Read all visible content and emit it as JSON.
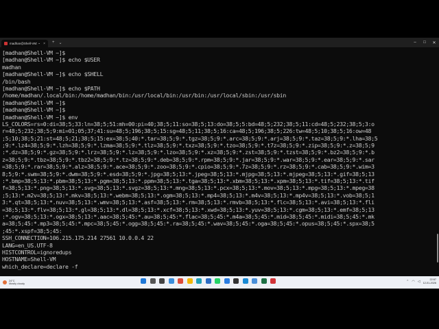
{
  "window": {
    "tab_title": "madhan@Shell-VM: ~",
    "close_glyph": "×",
    "new_tab_glyph": "+",
    "dropdown_glyph": "⌄",
    "min_glyph": "–",
    "max_glyph": "□",
    "close_win_glyph": "✕"
  },
  "terminal": {
    "lines": [
      "[madhan@Shell-VM ~]$",
      "[madhan@Shell-VM ~]$ echo $USER",
      "madhan",
      "[madhan@Shell-VM ~]$ echo $SHELL",
      "/bin/bash",
      "[madhan@Shell-VM ~]$ echo $PATH",
      "/home/madhan/.local/bin:/home/madhan/bin:/usr/local/bin:/usr/bin:/usr/local/sbin:/usr/sbin",
      "[madhan@Shell-VM ~]$",
      "[madhan@Shell-VM ~]$",
      "[madhan@Shell-VM ~]$ env",
      "LS_COLORS=rs=0:di=38;5;33:ln=38;5;51:mh=00:pi=40;38;5;11:so=38;5;13:do=38;5;5:bd=48;5;232;38;5;11:cd=48;5;232;38;5;3:o",
      "r=48;5;232;38;5;9:mi=01;05;37;41:su=48;5;196;38;5;15:sg=48;5;11;38;5;16:ca=48;5;196;38;5;226:tw=48;5;10;38;5;16:ow=48",
      ";5;10;38;5;21:st=48;5;21;38;5;15:ex=38;5;40:*.tar=38;5;9:*.tgz=38;5;9:*.arc=38;5;9:*.arj=38;5;9:*.taz=38;5;9:*.lha=38;5",
      ";9:*.lz4=38;5;9:*.lzh=38;5;9:*.lzma=38;5;9:*.tlz=38;5;9:*.txz=38;5;9:*.tzo=38;5;9:*.t7z=38;5;9:*.zip=38;5;9:*.z=38;5;9",
      ":*.dz=38;5;9:*.gz=38;5;9:*.lrz=38;5;9:*.lz=38;5;9:*.lzo=38;5;9:*.xz=38;5;9:*.zst=38;5;9:*.tzst=38;5;9:*.bz2=38;5;9:*.b",
      "z=38;5;9:*.tbz=38;5;9:*.tbz2=38;5;9:*.tz=38;5;9:*.deb=38;5;9:*.rpm=38;5;9:*.jar=38;5;9:*.war=38;5;9:*.ear=38;5;9:*.sar",
      "=38;5;9:*.rar=38;5;9:*.alz=38;5;9:*.ace=38;5;9:*.zoo=38;5;9:*.cpio=38;5;9:*.7z=38;5;9:*.rz=38;5;9:*.cab=38;5;9:*.wim=3",
      "8;5;9:*.swm=38;5;9:*.dwm=38;5;9:*.esd=38;5;9:*.jpg=38;5;13:*.jpeg=38;5;13:*.mjpg=38;5;13:*.mjpeg=38;5;13:*.gif=38;5;13",
      ":*.bmp=38;5;13:*.pbm=38;5;13:*.pgm=38;5;13:*.ppm=38;5;13:*.tga=38;5;13:*.xbm=38;5;13:*.xpm=38;5;13:*.tif=38;5;13:*.tif",
      "f=38;5;13:*.png=38;5;13:*.svg=38;5;13:*.svgz=38;5;13:*.mng=38;5;13:*.pcx=38;5;13:*.mov=38;5;13:*.mpg=38;5;13:*.mpeg=38",
      ";5;13:*.m2v=38;5;13:*.mkv=38;5;13:*.webm=38;5;13:*.ogm=38;5;13:*.mp4=38;5;13:*.m4v=38;5;13:*.mp4v=38;5;13:*.vob=38;5;1",
      "3:*.qt=38;5;13:*.nuv=38;5;13:*.wmv=38;5;13:*.asf=38;5;13:*.rm=38;5;13:*.rmvb=38;5;13:*.flc=38;5;13:*.avi=38;5;13:*.fli",
      "=38;5;13:*.flv=38;5;13:*.gl=38;5;13:*.dl=38;5;13:*.xcf=38;5;13:*.xwd=38;5;13:*.yuv=38;5;13:*.cgm=38;5;13:*.emf=38;5;13",
      ":*.ogv=38;5;13:*.ogx=38;5;13:*.aac=38;5;45:*.au=38;5;45:*.flac=38;5;45:*.m4a=38;5;45:*.mid=38;5;45:*.midi=38;5;45:*.mk",
      "a=38;5;45:*.mp3=38;5;45:*.mpc=38;5;45:*.ogg=38;5;45:*.ra=38;5;45:*.wav=38;5;45:*.oga=38;5;45:*.opus=38;5;45:*.spx=38;5",
      ";45:*.xspf=38;5;45:",
      "SSH_CONNECTION=106.215.175.214 27561 10.0.0.4 22",
      "LANG=en_US.UTF-8",
      "HISTCONTROL=ignoredups",
      "HOSTNAME=Shell-VM",
      "which_declare=declare -f"
    ]
  },
  "taskbar": {
    "weather_temp": "24°C",
    "weather_desc": "Mostly cloudy",
    "time": "22:57",
    "date": "12-01-2026",
    "icons": [
      {
        "name": "start-icon",
        "color": "#1e78d7"
      },
      {
        "name": "search-icon",
        "color": "#555555"
      },
      {
        "name": "task-view-icon",
        "color": "#444444"
      },
      {
        "name": "widgets-icon",
        "color": "#3b8edb"
      },
      {
        "name": "chrome-icon",
        "color": "#dd4b39"
      },
      {
        "name": "explorer-icon",
        "color": "#f2b705"
      },
      {
        "name": "edge-icon",
        "color": "#1fa0b8"
      },
      {
        "name": "store-icon",
        "color": "#2b6cc4"
      },
      {
        "name": "whatsapp-icon",
        "color": "#25d366"
      },
      {
        "name": "photos-icon",
        "color": "#2a7de1"
      },
      {
        "name": "terminal-icon",
        "color": "#333333"
      },
      {
        "name": "vscode-icon",
        "color": "#1a8ad4"
      },
      {
        "name": "app-icon",
        "color": "#4a90d9"
      },
      {
        "name": "excel-icon",
        "color": "#1d7044"
      },
      {
        "name": "media-icon",
        "color": "#d13438"
      }
    ]
  }
}
